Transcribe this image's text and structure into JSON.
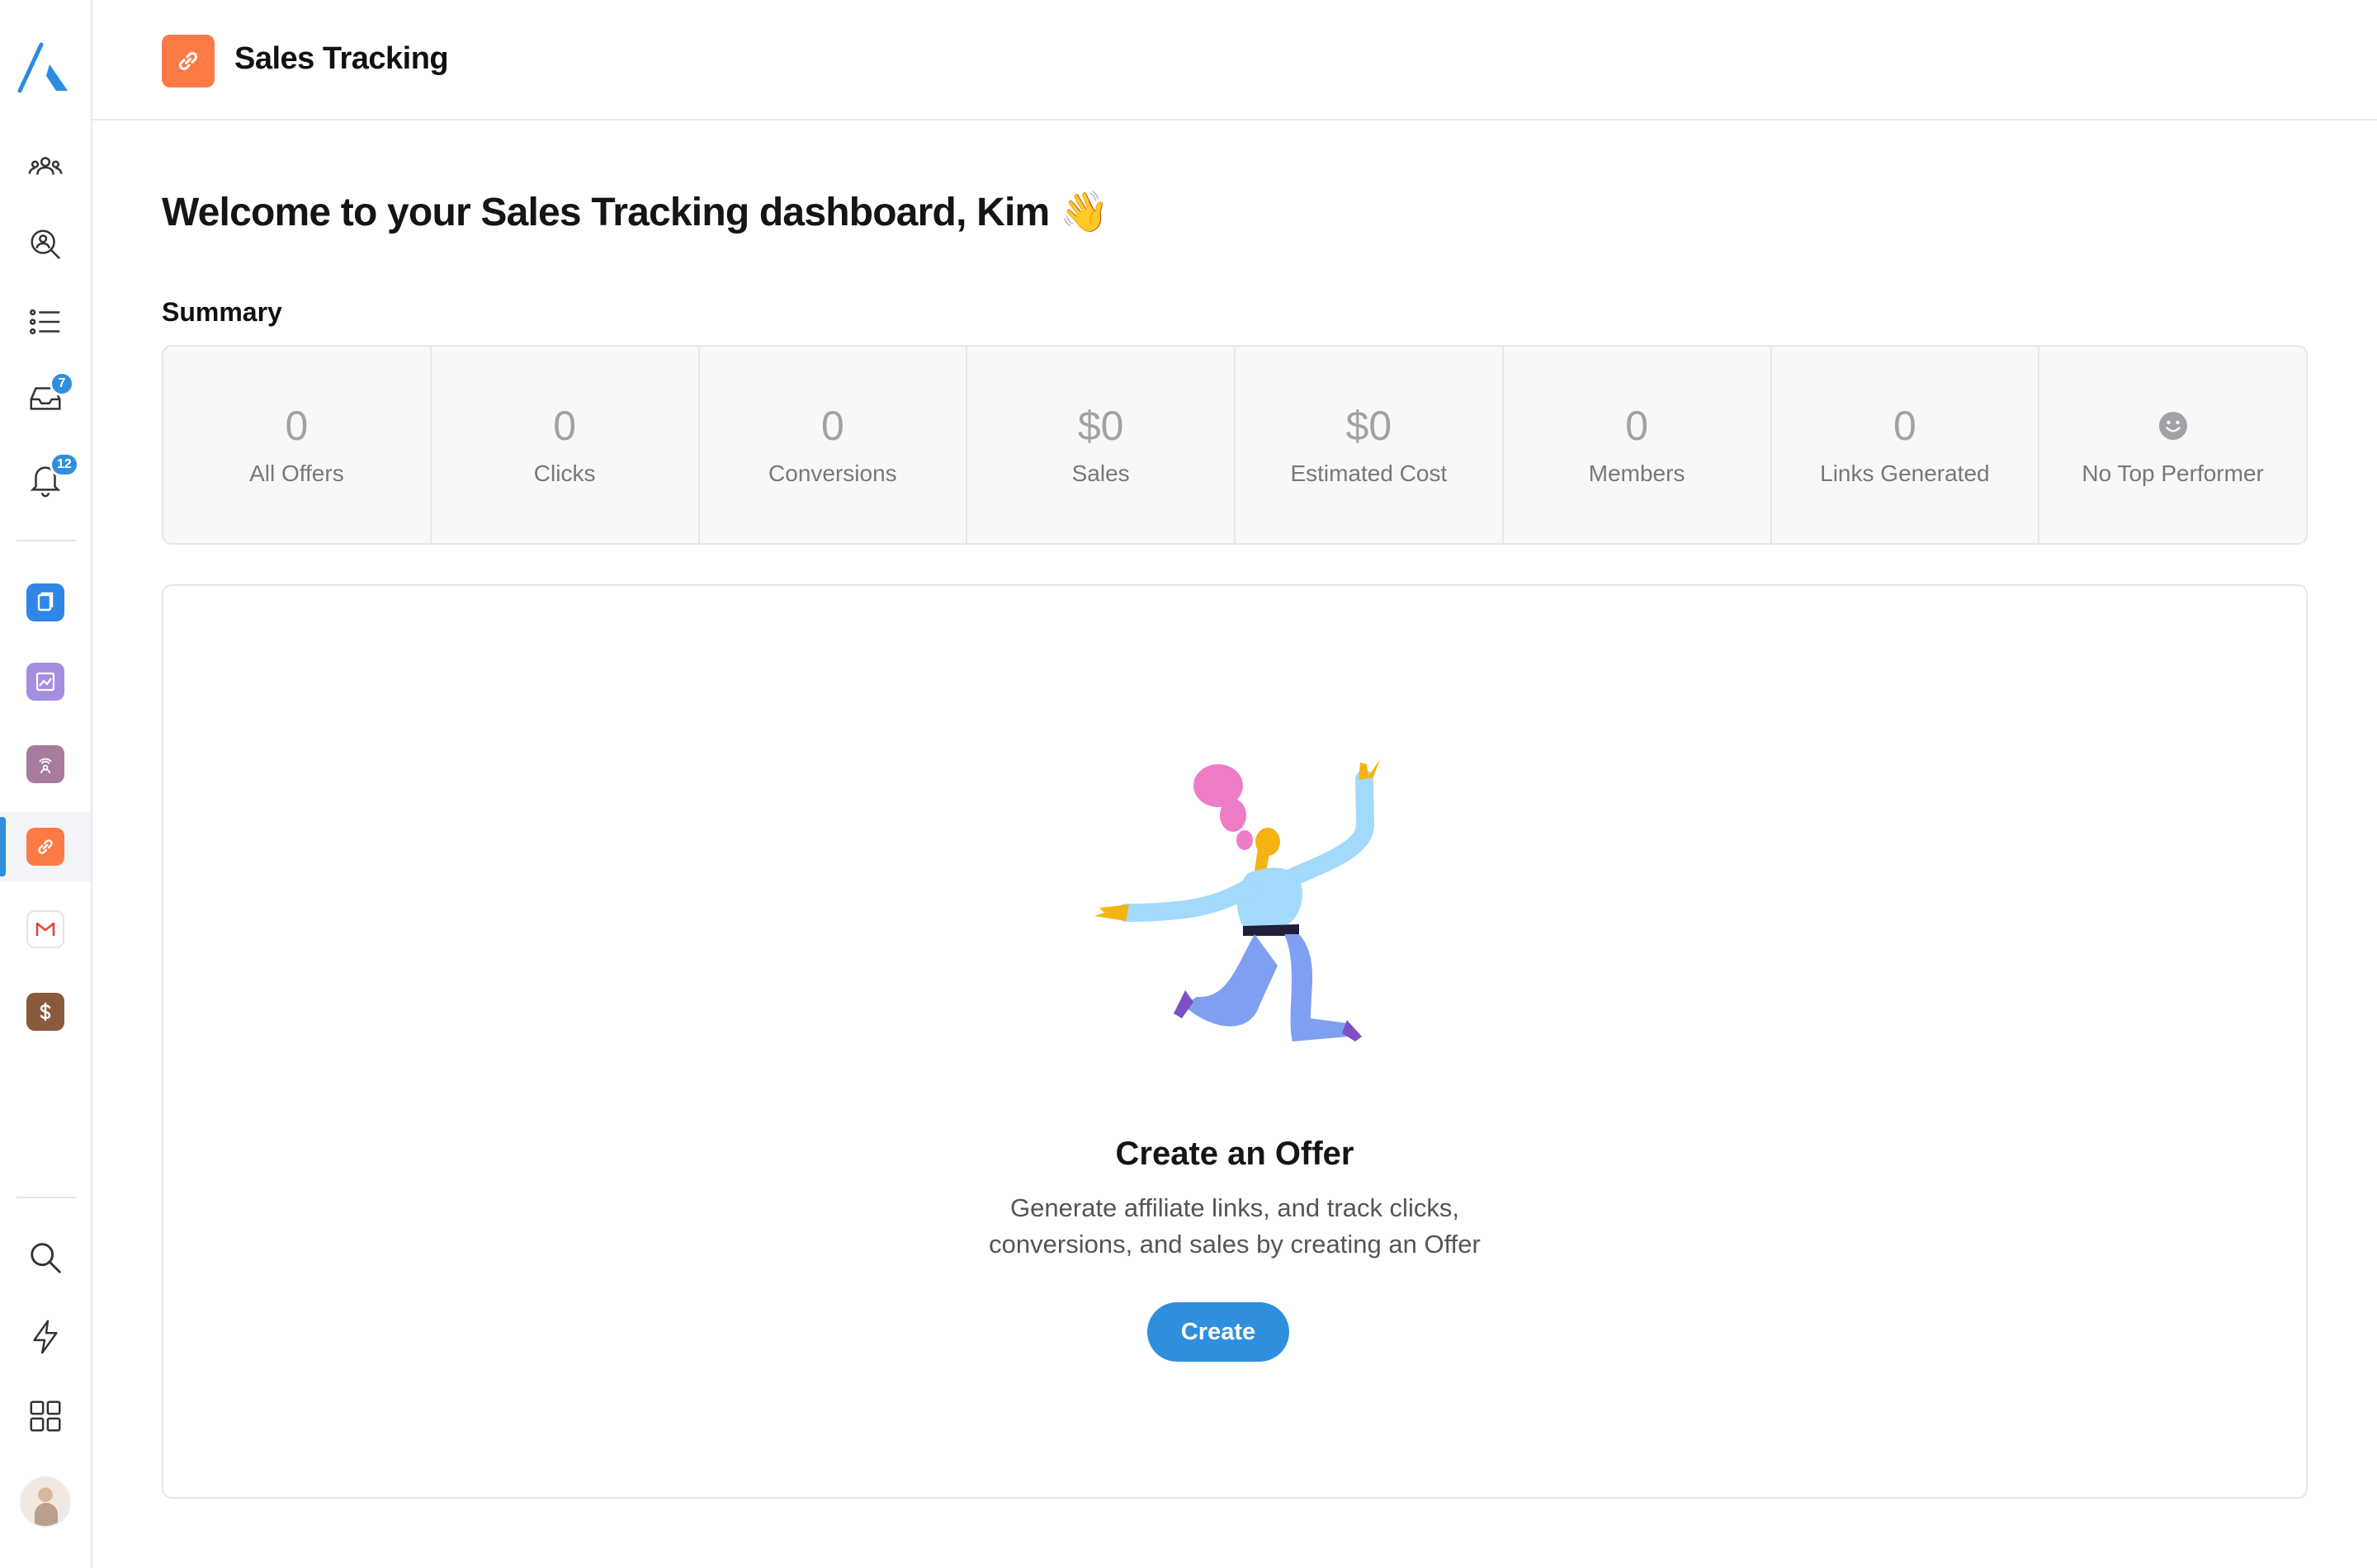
{
  "header": {
    "title": "Sales Tracking"
  },
  "welcome": {
    "text": "Welcome to your Sales Tracking dashboard, Kim",
    "emoji": "👋"
  },
  "summary": {
    "label": "Summary",
    "stats": [
      {
        "value": "0",
        "label": "All Offers"
      },
      {
        "value": "0",
        "label": "Clicks"
      },
      {
        "value": "0",
        "label": "Conversions"
      },
      {
        "value": "$0",
        "label": "Sales"
      },
      {
        "value": "$0",
        "label": "Estimated Cost"
      },
      {
        "value": "0",
        "label": "Members"
      },
      {
        "value": "0",
        "label": "Links Generated"
      },
      {
        "value": "",
        "label": "No Top Performer"
      }
    ]
  },
  "empty_state": {
    "title": "Create an Offer",
    "description": "Generate affiliate links, and track clicks, conversions, and sales by creating an Offer",
    "button_label": "Create"
  },
  "sidebar": {
    "nav_icons": [
      "members-icon",
      "search-people-icon",
      "list-icon",
      "inbox-icon",
      "bell-icon"
    ],
    "badges": {
      "inbox": "7",
      "notifications": "12"
    },
    "apps": [
      "pages-app",
      "gallery-app",
      "live-app",
      "sales-tracking-app",
      "email-app",
      "payments-app"
    ],
    "bottom_icons": [
      "search-icon",
      "lightning-icon",
      "apps-grid-icon"
    ]
  },
  "colors": {
    "accent": "#2f8fde",
    "sales_tracking": "#fb7a45",
    "pages_app": "#2f86e6",
    "gallery_app": "#a58ee0",
    "live_app": "#a77b9c",
    "payments_app": "#8a5a3c",
    "email_red": "#e0463a"
  }
}
